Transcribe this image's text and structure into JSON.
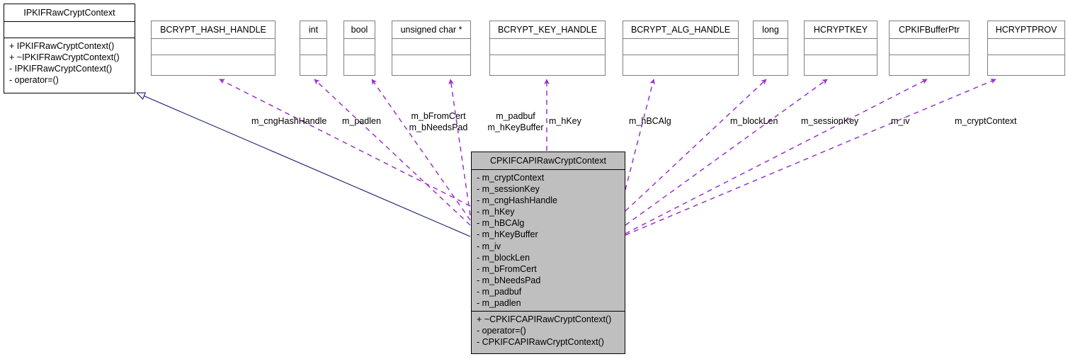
{
  "diagram": {
    "type": "uml-collaboration-diagram",
    "title": "CPKIFCAPIRawCryptContext collaboration diagram",
    "colors": {
      "association_edge": "#9A32CD",
      "inheritance_edge": "#191970",
      "focus_fill": "#BFBFBF",
      "box_border": "#7F7F7F",
      "focus_border": "#000000",
      "background": "#FFFFFF",
      "text": "#000000"
    }
  },
  "base_class": {
    "name": "IPKIFRawCryptContext",
    "attributes": [],
    "operations": [
      "+ IPKIFRawCryptContext()",
      "+ ~IPKIFRawCryptContext()",
      "- IPKIFRawCryptContext()",
      "- operator=()"
    ]
  },
  "focus_class": {
    "name": "CPKIFCAPIRawCryptContext",
    "attributes": [
      "- m_cryptContext",
      "- m_sessionKey",
      "- m_cngHashHandle",
      "- m_hKey",
      "- m_hBCAlg",
      "- m_hKeyBuffer",
      "- m_iv",
      "- m_blockLen",
      "- m_bFromCert",
      "- m_bNeedsPad",
      "- m_padbuf",
      "- m_padlen"
    ],
    "operations": [
      "+ ~CPKIFCAPIRawCryptContext()",
      "- operator=()",
      "- CPKIFCAPIRawCryptContext()"
    ]
  },
  "type_boxes": [
    {
      "name": "BCRYPT_HASH_HANDLE"
    },
    {
      "name": "int"
    },
    {
      "name": "bool"
    },
    {
      "name": "unsigned char *"
    },
    {
      "name": "BCRYPT_KEY_HANDLE"
    },
    {
      "name": "BCRYPT_ALG_HANDLE"
    },
    {
      "name": "long"
    },
    {
      "name": "HCRYPTKEY"
    },
    {
      "name": "CPKIFBufferPtr"
    },
    {
      "name": "HCRYPTPROV"
    }
  ],
  "edge_labels": [
    {
      "id": "cngHashHandle",
      "text": "m_cngHashHandle"
    },
    {
      "id": "padlen",
      "text": "m_padlen"
    },
    {
      "id": "fromCert",
      "text": "m_bFromCert"
    },
    {
      "id": "needsPad",
      "text": "m_bNeedsPad"
    },
    {
      "id": "padbuf",
      "text": "m_padbuf"
    },
    {
      "id": "hKeyBuffer",
      "text": "m_hKeyBuffer"
    },
    {
      "id": "hKey",
      "text": "m_hKey"
    },
    {
      "id": "hBCAlg",
      "text": "m_hBCAlg"
    },
    {
      "id": "blockLen",
      "text": "m_blockLen"
    },
    {
      "id": "sessionKey",
      "text": "m_sessionKey"
    },
    {
      "id": "iv",
      "text": "m_iv"
    },
    {
      "id": "cryptContext",
      "text": "m_cryptContext"
    }
  ]
}
